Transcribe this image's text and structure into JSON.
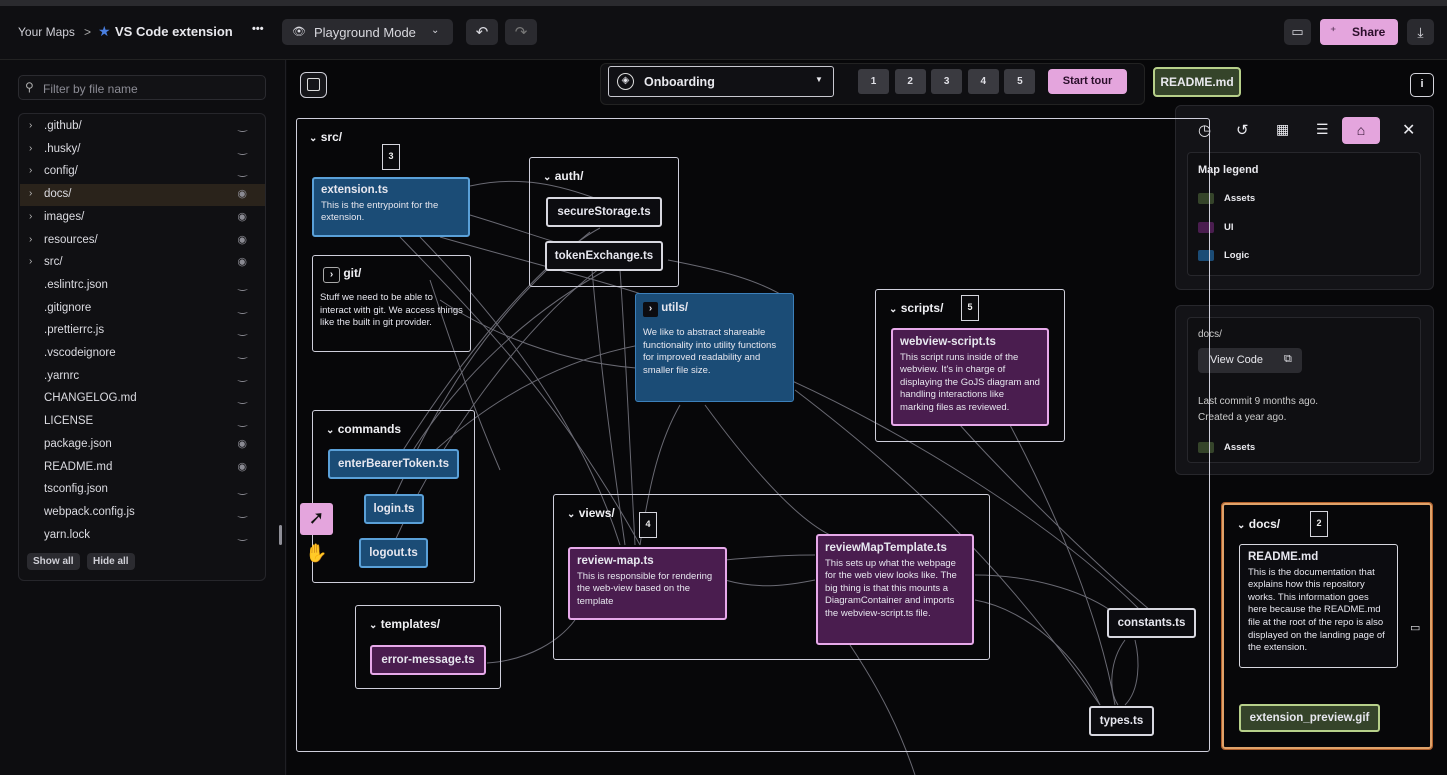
{
  "topbar": {
    "your_maps": "Your Maps",
    "separator": ">",
    "map_title": "VS Code extension",
    "more": "•••",
    "mode": "Playground Mode",
    "share": "Share"
  },
  "sidebar": {
    "filter_placeholder": "Filter by file name",
    "items": [
      {
        "label": ".github/",
        "folder": true,
        "visible": false
      },
      {
        "label": ".husky/",
        "folder": true,
        "visible": false
      },
      {
        "label": "config/",
        "folder": true,
        "visible": false
      },
      {
        "label": "docs/",
        "folder": true,
        "visible": true
      },
      {
        "label": "images/",
        "folder": true,
        "visible": true
      },
      {
        "label": "resources/",
        "folder": true,
        "visible": true
      },
      {
        "label": "src/",
        "folder": true,
        "visible": true
      },
      {
        "label": ".eslintrc.json",
        "folder": false,
        "visible": false
      },
      {
        "label": ".gitignore",
        "folder": false,
        "visible": false
      },
      {
        "label": ".prettierrc.js",
        "folder": false,
        "visible": false
      },
      {
        "label": ".vscodeignore",
        "folder": false,
        "visible": false
      },
      {
        "label": ".yarnrc",
        "folder": false,
        "visible": false
      },
      {
        "label": "CHANGELOG.md",
        "folder": false,
        "visible": false
      },
      {
        "label": "LICENSE",
        "folder": false,
        "visible": false
      },
      {
        "label": "package.json",
        "folder": false,
        "visible": true
      },
      {
        "label": "README.md",
        "folder": false,
        "visible": true
      },
      {
        "label": "tsconfig.json",
        "folder": false,
        "visible": false
      },
      {
        "label": "webpack.config.js",
        "folder": false,
        "visible": false
      },
      {
        "label": "yarn.lock",
        "folder": false,
        "visible": false
      }
    ],
    "show_all": "Show all",
    "hide_all": "Hide all"
  },
  "tour": {
    "selected": "Onboarding",
    "steps": [
      "1",
      "2",
      "3",
      "4",
      "5"
    ],
    "start": "Start tour",
    "readme": "README.md"
  },
  "legend": {
    "title": "Map legend",
    "items": [
      {
        "label": "Assets",
        "color": "#35442a"
      },
      {
        "label": "UI",
        "color": "#4a1d4f"
      },
      {
        "label": "Logic",
        "color": "#1b4c76"
      }
    ]
  },
  "details": {
    "path": "docs/",
    "view_code": "View Code",
    "last_commit": "Last commit 9 months ago.",
    "created": "Created a year ago.",
    "tag": "Assets"
  },
  "map": {
    "src": "src/",
    "auth": "auth/",
    "git": "git/",
    "git_desc": "Stuff we need to be able to interact with git. We access things like the built in git provider.",
    "utils": "utils/",
    "utils_desc": "We like to abstract shareable functionality into utility functions for improved readability and smaller file size.",
    "scripts": "scripts/",
    "commands": "commands",
    "views": "views/",
    "templates": "templates/",
    "docs": "docs/",
    "badge_src": "3",
    "badge_scripts": "5",
    "badge_views": "4",
    "badge_docs": "2",
    "extension": "extension.ts",
    "extension_desc": "This is the entrypoint for the extension.",
    "secure": "secureStorage.ts",
    "token": "tokenExchange.ts",
    "webview": "webview-script.ts",
    "webview_desc": "This script runs inside of the webview. It's in charge of displaying the GoJS diagram and handling interactions like marking files as reviewed.",
    "bearer": "enterBearerToken.ts",
    "login": "login.ts",
    "logout": "logout.ts",
    "reviewmap": "review-map.ts",
    "reviewmap_desc": "This is responsible for rendering the web-view based on the template",
    "template": "reviewMapTemplate.ts",
    "template_desc": "This sets up what the webpage for the web view looks like. The big thing is that this mounts a DiagramContainer and imports the webview-script.ts file.",
    "errmsg": "error-message.ts",
    "constants": "constants.ts",
    "types": "types.ts",
    "readme": "README.md",
    "readme_desc": "This is the documentation that explains how this repository works. This information goes here because the README.md file at the root of the repo is also displayed on the landing page of the extension.",
    "preview": "extension_preview.gif"
  }
}
